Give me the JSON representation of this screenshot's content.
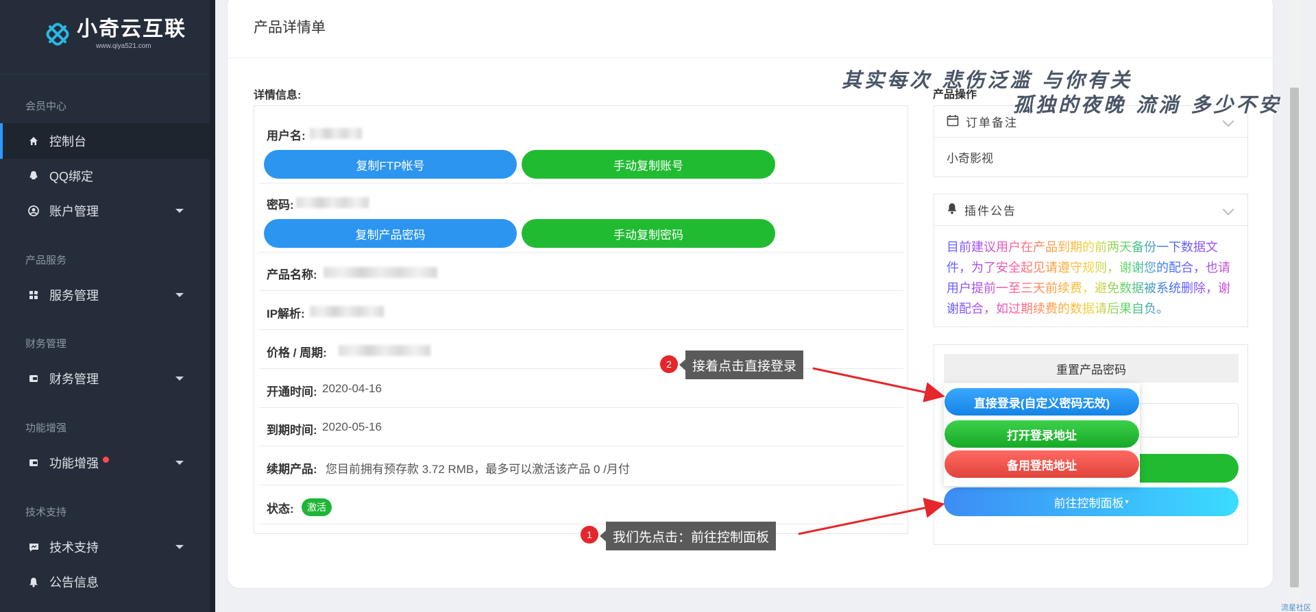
{
  "brand": {
    "name": "小奇云互联",
    "url": "www.qiya521.com"
  },
  "sidebar": {
    "sections": [
      {
        "title": "会员中心",
        "items": [
          {
            "label": "控制台",
            "icon": "home-icon"
          },
          {
            "label": "QQ绑定",
            "icon": "qq-icon"
          },
          {
            "label": "账户管理",
            "icon": "user-circle-icon"
          }
        ]
      },
      {
        "title": "产品服务",
        "items": [
          {
            "label": "服务管理",
            "icon": "grid-icon"
          }
        ]
      },
      {
        "title": "财务管理",
        "items": [
          {
            "label": "财务管理",
            "icon": "wallet-icon"
          }
        ]
      },
      {
        "title": "功能增强",
        "items": [
          {
            "label": "功能增强",
            "icon": "wallet-icon"
          }
        ]
      },
      {
        "title": "技术支持",
        "items": [
          {
            "label": "技术支持",
            "icon": "chat-icon"
          },
          {
            "label": "公告信息",
            "icon": "bell-icon"
          }
        ]
      }
    ]
  },
  "page": {
    "title": "产品详情单"
  },
  "details": {
    "heading": "详情信息:",
    "username_label": "用户名:",
    "copy_ftp_label": "复制FTP帐号",
    "manual_copy_account_label": "手动复制账号",
    "password_label": "密码:",
    "copy_password_label": "复制产品密码",
    "manual_copy_password_label": "手动复制密码",
    "product_name_label": "产品名称:",
    "ip_label": "IP解析:",
    "price_label": "价格 / 周期:",
    "open_time_label": "开通时间:",
    "open_time": "2020-04-16",
    "expire_time_label": "到期时间:",
    "expire_time": "2020-05-16",
    "renew_label": "续期产品:",
    "renew_text": "您目前拥有预存款 3.72 RMB，最多可以激活该产品 0 /月付",
    "status_label": "状态:",
    "status": "激活"
  },
  "operations": {
    "heading": "产品操作",
    "order_note_title": "订单备注",
    "order_note": "小奇影视",
    "plugin_notice_title": "插件公告",
    "plugin_notice": "目前建议用户在产品到期的前两天备份一下数据文件，为了安全起见请遵守规则，谢谢您的配合，也请用户提前一至三天前续费，避免数据被系统删除，谢谢配合，如过期续费的数据请后果自负。",
    "reset_password_label": "重置产品密码",
    "direct_login_label": "直接登录(自定义密码无效)",
    "open_login_url_label": "打开登录地址",
    "backup_login_url_label": "备用登陆地址",
    "control_panel_label": "前往控制面板"
  },
  "annotations": {
    "step1_num": "1",
    "step1_text": "我们先点击：前往控制面板",
    "step2_num": "2",
    "step2_text": "接着点击直接登录"
  },
  "lyrics": {
    "line1": "其实每次 悲伤泛滥 与你有关",
    "line2": "孤独的夜晚 流淌 多少不安"
  },
  "watermark": "流星社区"
}
